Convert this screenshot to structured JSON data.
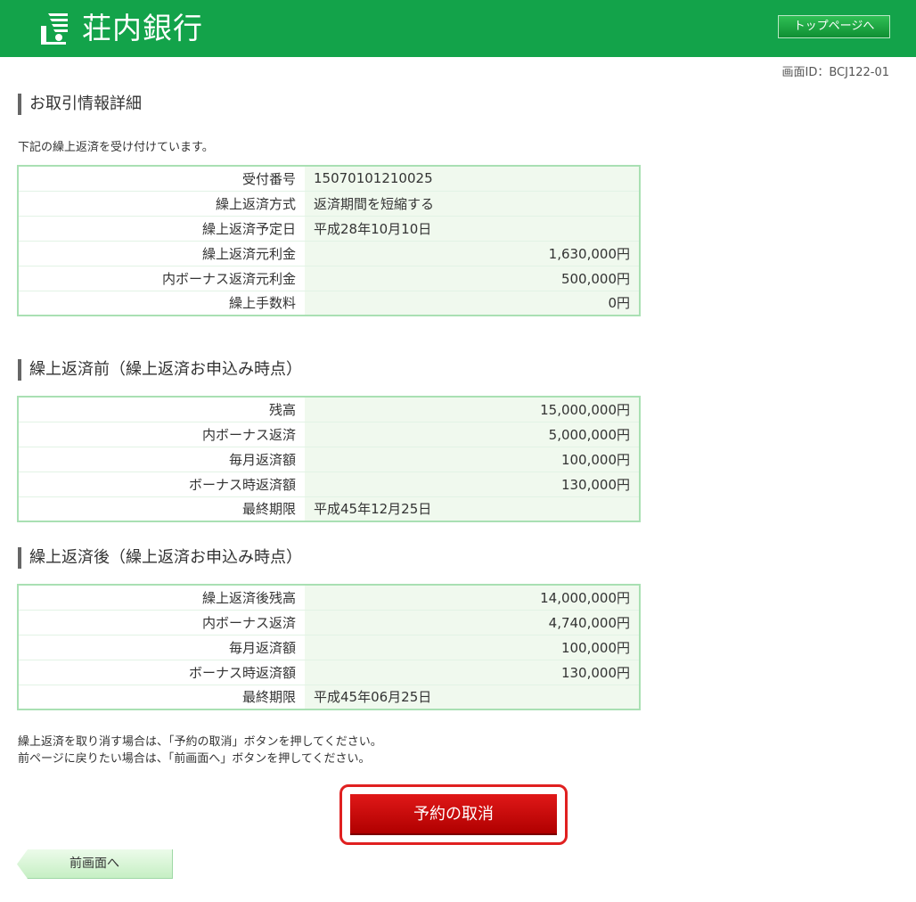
{
  "header": {
    "bank_name": "荘内銀行",
    "top_page_button": "トップページへ",
    "accent_color": "#13a34a"
  },
  "screen_id": "画面ID：BCJ122-01",
  "section1": {
    "title": "お取引情報詳細",
    "description": "下記の繰上返済を受け付けています。",
    "rows": [
      {
        "label": "受付番号",
        "value": "15070101210025",
        "align": "left"
      },
      {
        "label": "繰上返済方式",
        "value": "返済期間を短縮する",
        "align": "left"
      },
      {
        "label": "繰上返済予定日",
        "value": "平成28年10月10日",
        "align": "left"
      },
      {
        "label": "繰上返済元利金",
        "value": "1,630,000円",
        "align": "right"
      },
      {
        "label": "内ボーナス返済元利金",
        "value": "500,000円",
        "align": "right"
      },
      {
        "label": "繰上手数料",
        "value": "0円",
        "align": "right"
      }
    ]
  },
  "section2": {
    "title": "繰上返済前（繰上返済お申込み時点）",
    "rows": [
      {
        "label": "残高",
        "value": "15,000,000円",
        "align": "right"
      },
      {
        "label": "内ボーナス返済",
        "value": "5,000,000円",
        "align": "right"
      },
      {
        "label": "毎月返済額",
        "value": "100,000円",
        "align": "right"
      },
      {
        "label": "ボーナス時返済額",
        "value": "130,000円",
        "align": "right"
      },
      {
        "label": "最終期限",
        "value": "平成45年12月25日",
        "align": "left"
      }
    ]
  },
  "section3": {
    "title": "繰上返済後（繰上返済お申込み時点）",
    "rows": [
      {
        "label": "繰上返済後残高",
        "value": "14,000,000円",
        "align": "right"
      },
      {
        "label": "内ボーナス返済",
        "value": "4,740,000円",
        "align": "right"
      },
      {
        "label": "毎月返済額",
        "value": "100,000円",
        "align": "right"
      },
      {
        "label": "ボーナス時返済額",
        "value": "130,000円",
        "align": "right"
      },
      {
        "label": "最終期限",
        "value": "平成45年06月25日",
        "align": "left"
      }
    ]
  },
  "notes": [
    "繰上返済を取り消す場合は、「予約の取消」ボタンを押してください。",
    "前ページに戻りたい場合は、「前画面へ」ボタンを押してください。"
  ],
  "buttons": {
    "cancel": "予約の取消",
    "back": "前画面へ"
  }
}
